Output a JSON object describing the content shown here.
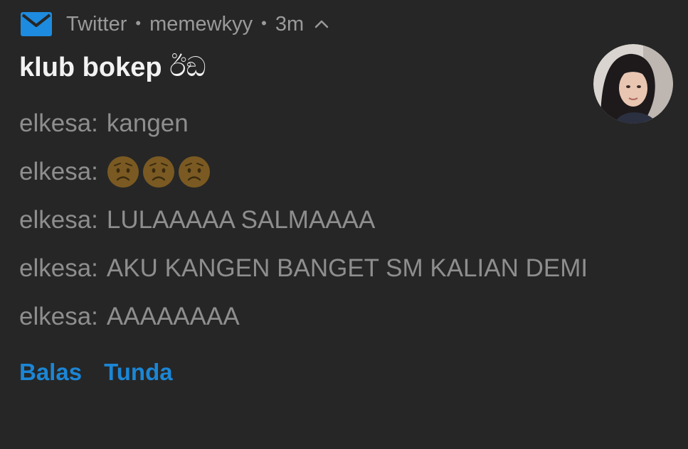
{
  "header": {
    "app_icon": "mail-envelope-icon",
    "app_icon_color": "#1d8be0",
    "app_name": "Twitter",
    "separator": "•",
    "account": "memewkyy",
    "time": "3m",
    "collapse_icon": "chevron-up-icon"
  },
  "title": {
    "text": "klub bokep",
    "glyph": "ඊඞ"
  },
  "messages": [
    {
      "sender": "elkesa",
      "text": "kangen"
    },
    {
      "sender": "elkesa",
      "text": "",
      "emoji": [
        "worried-face-icon",
        "worried-face-icon",
        "worried-face-icon"
      ]
    },
    {
      "sender": "elkesa",
      "text": "LULAAAAA SALMAAAA"
    },
    {
      "sender": "elkesa",
      "text": "AKU KANGEN BANGET SM KALIAN DEMI"
    },
    {
      "sender": "elkesa",
      "text": "AAAAAAAA"
    }
  ],
  "actions": {
    "reply": "Balas",
    "snooze": "Tunda",
    "color": "#1b86d6"
  },
  "avatar_icon": "profile-photo-avatar"
}
